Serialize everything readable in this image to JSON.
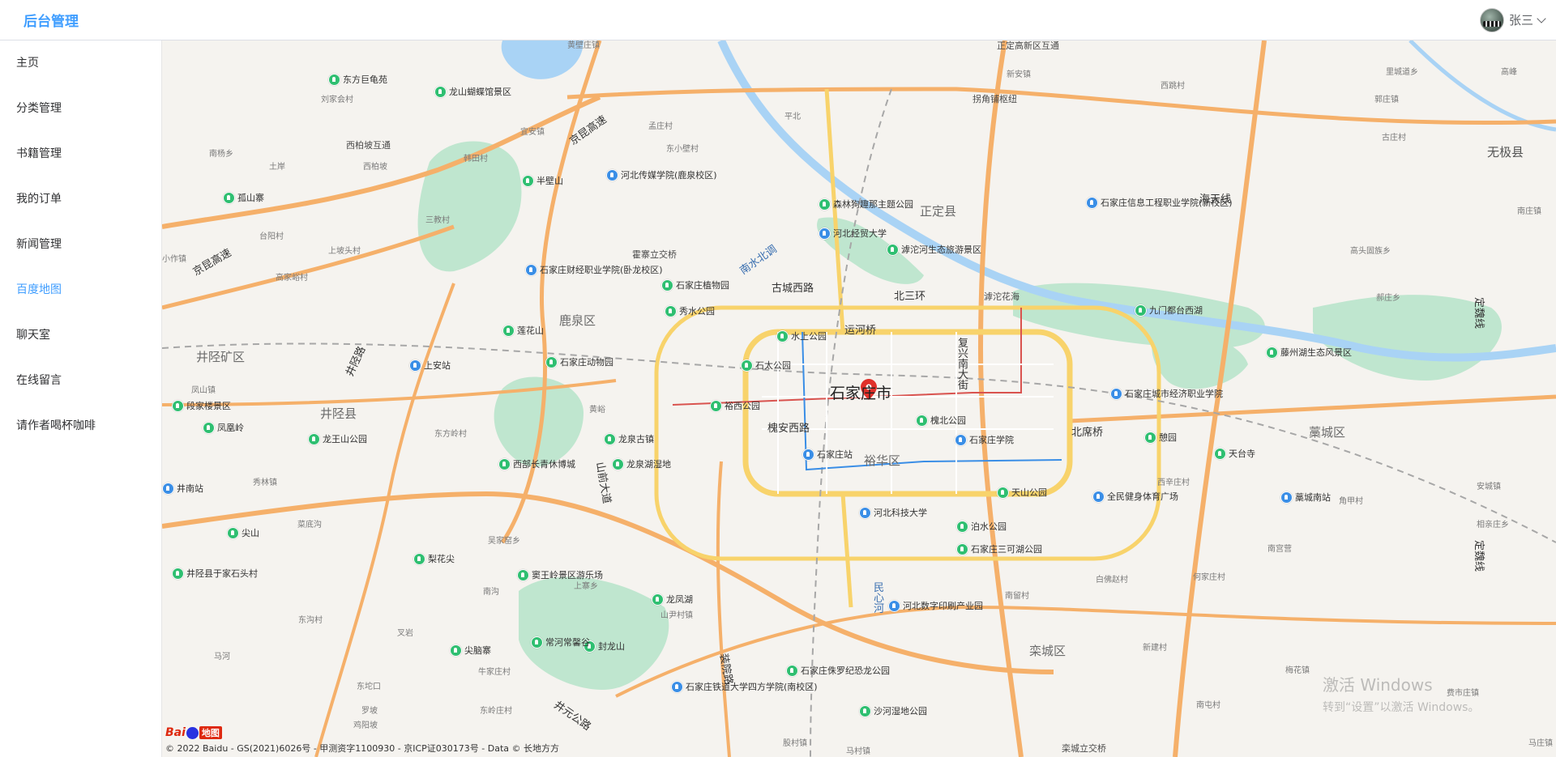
{
  "header": {
    "brand": "后台管理",
    "user_name": "张三"
  },
  "sidebar": {
    "active_index": 5,
    "items": [
      {
        "label": "主页"
      },
      {
        "label": "分类管理"
      },
      {
        "label": "书籍管理"
      },
      {
        "label": "我的订单"
      },
      {
        "label": "新闻管理"
      },
      {
        "label": "百度地图"
      },
      {
        "label": "聊天室"
      },
      {
        "label": "在线留言"
      },
      {
        "label": "请作者喝杯咖啡"
      }
    ]
  },
  "map": {
    "city_label": "石家庄市",
    "districts": {
      "luquan": "鹿泉区",
      "yuhua": "裕华区",
      "gaocheng": "藁城区",
      "luancheng": "栾城区",
      "jingxing_mine": "井陉矿区",
      "jingxing": "井陉县",
      "zhengding": "正定县",
      "wuji": "无极县"
    },
    "roads": {
      "gucheng_xi": "古城西路",
      "huaian_xi": "槐安西路",
      "beisanhuan": "北三环",
      "yunhe_qiao": "运河桥",
      "fuxing_nan": "复兴南大街",
      "beixi_qiao": "北席桥",
      "jingkun": "京昆高速",
      "jinghu": "京昆高速",
      "nanshui": "南水北调",
      "shanqian": "山前大道",
      "jingxing_road": "井陉路",
      "zhuangyuan": "装院路",
      "jingyuan": "井元公路",
      "minxin_he": "民心河",
      "huosi": "霍寨立交桥",
      "hutuo": "滹沱花海",
      "haitianxian": "海天线",
      "dingwei1": "定魏线",
      "dingwei2": "定魏线",
      "zhengding_new": "正定高新区互通",
      "guaijiao": "拐角铺枢纽",
      "xibai": "西柏坡互通",
      "luancheng_li": "栾城立交桥"
    },
    "pois": {
      "shijiazhuang_zoo": "石家庄动物园",
      "shuishang": "水上公园",
      "shitai": "石太公园",
      "yuxi": "裕西公园",
      "huaibei": "槐北公园",
      "shijiazhuang_zhan": "石家庄站",
      "shi_college": "石家庄学院",
      "hebei_keji": "河北科技大学",
      "tianshan": "天山公园",
      "bohui": "泊水公园",
      "sanke": "石家庄三可湖公园",
      "quanmin": "全民健身体育广场",
      "zhiwuyuan": "石家庄植物园",
      "xiushui": "秀水公园",
      "senlin": "森林狗趣那主题公园",
      "jingmao": "河北经贸大学",
      "hutuo_stage": "滹沱河生态旅游景区",
      "xinxi": "石家庄信息工程职业学院(新校区)",
      "jiumen": "九门都台西湖",
      "tangzhou": "藤州湖生态风景区",
      "chengshi": "石家庄城市经济职业学院",
      "jiuyuan": "憩园",
      "tiantai": "天台寺",
      "caijing": "石家庄财经职业学院(卧龙校区)",
      "chuanmei": "河北传媒学院(鹿泉校区)",
      "banbishan": "半壁山",
      "longshan": "龙山蝴蝶馆景区",
      "dongfang": "东方巨龟苑",
      "gushan": "孤山寨",
      "lianhua": "莲花山",
      "shangan": "上安站",
      "duanjia": "段家楼景区",
      "fenghuang": "凤凰岭",
      "longwang": "龙王山公园",
      "jingnan": "井南站",
      "jianshan": "尖山",
      "yujia": "井陉县于家石头村",
      "lihua": "梨花尖",
      "longquan_gu": "龙泉古镇",
      "longquan_hu": "龙泉湖湿地",
      "xixi": "西部长青休博城",
      "douling": "窦王岭景区游乐场",
      "longfeng": "龙凤湖",
      "fenglong": "封龙山",
      "changhe": "常河常馨谷",
      "jiannao": "尖脑寨",
      "tiedao": "石家庄铁道大学四方学院(南校区)",
      "hebei_shuzi": "河北数字印刷产业园",
      "kongling": "石家庄侏罗纪恐龙公园",
      "shahe": "沙河湿地公园",
      "gaocheng_nan": "藁城南站"
    },
    "towns": [
      "黄壁庄镇",
      "新安镇",
      "里城道乡",
      "郭庄镇",
      "西柏坡",
      "宜安镇",
      "孟庄村",
      "东小壁村",
      "平北",
      "南杨乡",
      "土岸",
      "韩田村",
      "三教村",
      "台阳村",
      "小作镇",
      "高家峪村",
      "上坡头村",
      "南庄镇",
      "凤山镇",
      "秀林镇",
      "东方岭村",
      "黄峪",
      "南沟",
      "上寨乡",
      "山尹村镇",
      "吴家窑乡",
      "菜底沟",
      "东沟村",
      "马河",
      "东坨口",
      "叉岩",
      "罗坡",
      "鸡阳坡",
      "牛家庄村",
      "东岭庄村",
      "南宫营",
      "何家庄村",
      "新建村",
      "梅花镇",
      "南屯村",
      "角甲村",
      "马庄镇",
      "西辛庄村",
      "相亲庄乡",
      "白佛赵村",
      "南留村",
      "股村镇",
      "马村镇",
      "刘家会村",
      "安城镇",
      "郝庄乡",
      "高头固族乡",
      "西跳村",
      "古庄村",
      "高峰",
      "费市庄镇"
    ],
    "watermark": {
      "line1": "激活 Windows",
      "line2": "转到“设置”以激活 Windows。"
    },
    "logo_text": "Bai",
    "logo_sub": "地图",
    "copyright": "© 2022 Baidu - GS(2021)6026号 - 甲测资字1100930 - 京ICP证030173号 - Data © 长地方方"
  }
}
